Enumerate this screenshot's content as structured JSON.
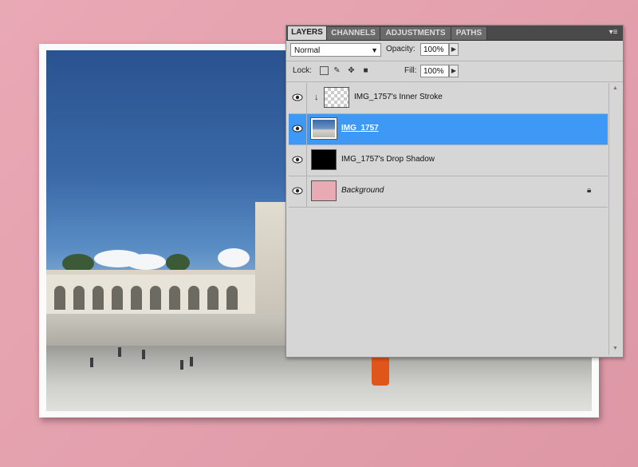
{
  "panel": {
    "tabs": [
      "LAYERS",
      "CHANNELS",
      "ADJUSTMENTS",
      "PATHS"
    ],
    "active_tab": "LAYERS",
    "menu_icon": "panel-menu-icon"
  },
  "controls": {
    "blend_mode": "Normal",
    "opacity_label": "Opacity:",
    "opacity_value": "100%",
    "lock_label": "Lock:",
    "fill_label": "Fill:",
    "fill_value": "100%"
  },
  "layers": [
    {
      "name": "IMG_1757's Inner Stroke",
      "thumb": "checker",
      "clipped": true,
      "visible": true,
      "selected": false
    },
    {
      "name": "IMG_1757",
      "thumb": "photo",
      "clipped": false,
      "visible": true,
      "selected": true
    },
    {
      "name": "IMG_1757's Drop Shadow",
      "thumb": "black",
      "clipped": false,
      "visible": true,
      "selected": false
    },
    {
      "name": "Background",
      "thumb": "pink",
      "clipped": false,
      "visible": true,
      "selected": false,
      "locked": true
    }
  ],
  "colors": {
    "canvas_bg": "#e4a0ad",
    "selection": "#3d98f6",
    "panel_bg": "#d6d6d6"
  }
}
